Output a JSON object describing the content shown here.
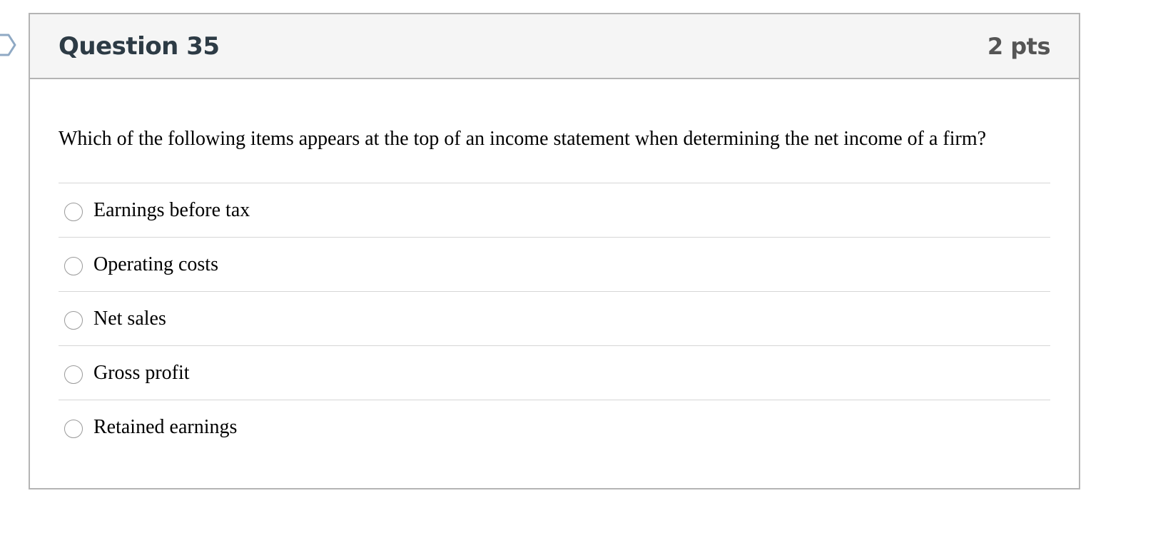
{
  "question": {
    "title": "Question 35",
    "points": "2 pts",
    "text": "Which of the following items appears at the top of an income statement when determining the net income of a firm?",
    "answers": [
      {
        "label": "Earnings before tax",
        "selected": false
      },
      {
        "label": "Operating costs",
        "selected": false
      },
      {
        "label": "Net sales",
        "selected": false
      },
      {
        "label": "Gross profit",
        "selected": false
      },
      {
        "label": "Retained earnings",
        "selected": false
      }
    ]
  },
  "icons": {
    "flag": "flag-question-icon"
  },
  "colors": {
    "title": "#2d3b45",
    "points": "#555555",
    "header_bg": "#f5f5f5",
    "border": "#b4b4b4",
    "flag": "#8fa9c4"
  }
}
